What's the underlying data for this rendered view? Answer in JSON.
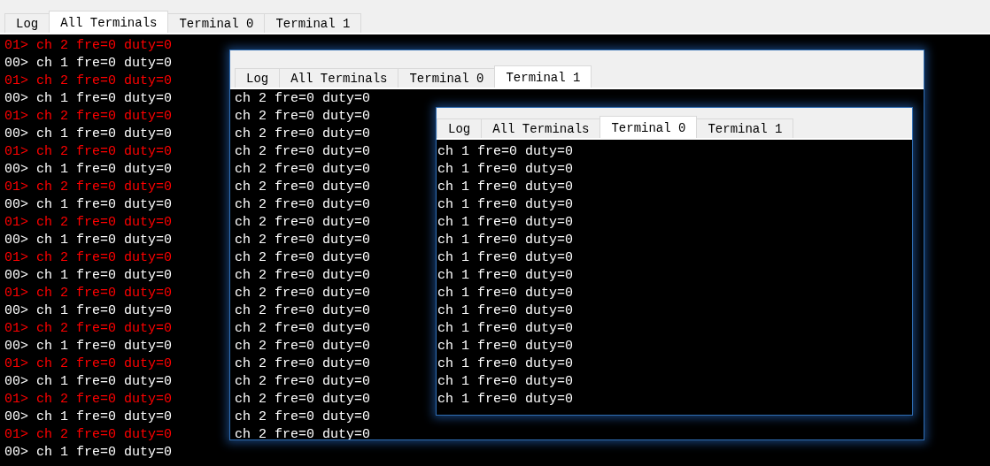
{
  "main_window": {
    "tabs": [
      {
        "label": "Log",
        "selected": false
      },
      {
        "label": "All Terminals",
        "selected": true
      },
      {
        "label": "Terminal 0",
        "selected": false
      },
      {
        "label": "Terminal 1",
        "selected": false
      }
    ],
    "lines": [
      {
        "text": "01> ch 2 fre=0 duty=0",
        "color": "#ff0000"
      },
      {
        "text": "00> ch 1 fre=0 duty=0",
        "color": "#ffffff"
      },
      {
        "text": "01> ch 2 fre=0 duty=0",
        "color": "#ff0000"
      },
      {
        "text": "00> ch 1 fre=0 duty=0",
        "color": "#ffffff"
      },
      {
        "text": "01> ch 2 fre=0 duty=0",
        "color": "#ff0000"
      },
      {
        "text": "00> ch 1 fre=0 duty=0",
        "color": "#ffffff"
      },
      {
        "text": "01> ch 2 fre=0 duty=0",
        "color": "#ff0000"
      },
      {
        "text": "00> ch 1 fre=0 duty=0",
        "color": "#ffffff"
      },
      {
        "text": "01> ch 2 fre=0 duty=0",
        "color": "#ff0000"
      },
      {
        "text": "00> ch 1 fre=0 duty=0",
        "color": "#ffffff"
      },
      {
        "text": "01> ch 2 fre=0 duty=0",
        "color": "#ff0000"
      },
      {
        "text": "00> ch 1 fre=0 duty=0",
        "color": "#ffffff"
      },
      {
        "text": "01> ch 2 fre=0 duty=0",
        "color": "#ff0000"
      },
      {
        "text": "00> ch 1 fre=0 duty=0",
        "color": "#ffffff"
      },
      {
        "text": "01> ch 2 fre=0 duty=0",
        "color": "#ff0000"
      },
      {
        "text": "00> ch 1 fre=0 duty=0",
        "color": "#ffffff"
      },
      {
        "text": "01> ch 2 fre=0 duty=0",
        "color": "#ff0000"
      },
      {
        "text": "00> ch 1 fre=0 duty=0",
        "color": "#ffffff"
      },
      {
        "text": "01> ch 2 fre=0 duty=0",
        "color": "#ff0000"
      },
      {
        "text": "00> ch 1 fre=0 duty=0",
        "color": "#ffffff"
      },
      {
        "text": "01> ch 2 fre=0 duty=0",
        "color": "#ff0000"
      },
      {
        "text": "00> ch 1 fre=0 duty=0",
        "color": "#ffffff"
      },
      {
        "text": "01> ch 2 fre=0 duty=0",
        "color": "#ff0000"
      },
      {
        "text": "00> ch 1 fre=0 duty=0",
        "color": "#ffffff"
      }
    ]
  },
  "windows": [
    {
      "tabs": [
        {
          "label": "Log",
          "selected": false
        },
        {
          "label": "All Terminals",
          "selected": false
        },
        {
          "label": "Terminal 0",
          "selected": false
        },
        {
          "label": "Terminal 1",
          "selected": true
        }
      ],
      "lines": [
        "ch 2 fre=0 duty=0",
        "ch 2 fre=0 duty=0",
        "ch 2 fre=0 duty=0",
        "ch 2 fre=0 duty=0",
        "ch 2 fre=0 duty=0",
        "ch 2 fre=0 duty=0",
        "ch 2 fre=0 duty=0",
        "ch 2 fre=0 duty=0",
        "ch 2 fre=0 duty=0",
        "ch 2 fre=0 duty=0",
        "ch 2 fre=0 duty=0",
        "ch 2 fre=0 duty=0",
        "ch 2 fre=0 duty=0",
        "ch 2 fre=0 duty=0",
        "ch 2 fre=0 duty=0",
        "ch 2 fre=0 duty=0",
        "ch 2 fre=0 duty=0",
        "ch 2 fre=0 duty=0",
        "ch 2 fre=0 duty=0",
        "ch 2 fre=0 duty=0"
      ]
    },
    {
      "tabs": [
        {
          "label": "Log",
          "selected": false
        },
        {
          "label": "All Terminals",
          "selected": false
        },
        {
          "label": "Terminal 0",
          "selected": true
        },
        {
          "label": "Terminal 1",
          "selected": false
        }
      ],
      "lines": [
        "ch 1 fre=0 duty=0",
        "ch 1 fre=0 duty=0",
        "ch 1 fre=0 duty=0",
        "ch 1 fre=0 duty=0",
        "ch 1 fre=0 duty=0",
        "ch 1 fre=0 duty=0",
        "ch 1 fre=0 duty=0",
        "ch 1 fre=0 duty=0",
        "ch 1 fre=0 duty=0",
        "ch 1 fre=0 duty=0",
        "ch 1 fre=0 duty=0",
        "ch 1 fre=0 duty=0",
        "ch 1 fre=0 duty=0",
        "ch 1 fre=0 duty=0",
        "ch 1 fre=0 duty=0"
      ]
    }
  ]
}
